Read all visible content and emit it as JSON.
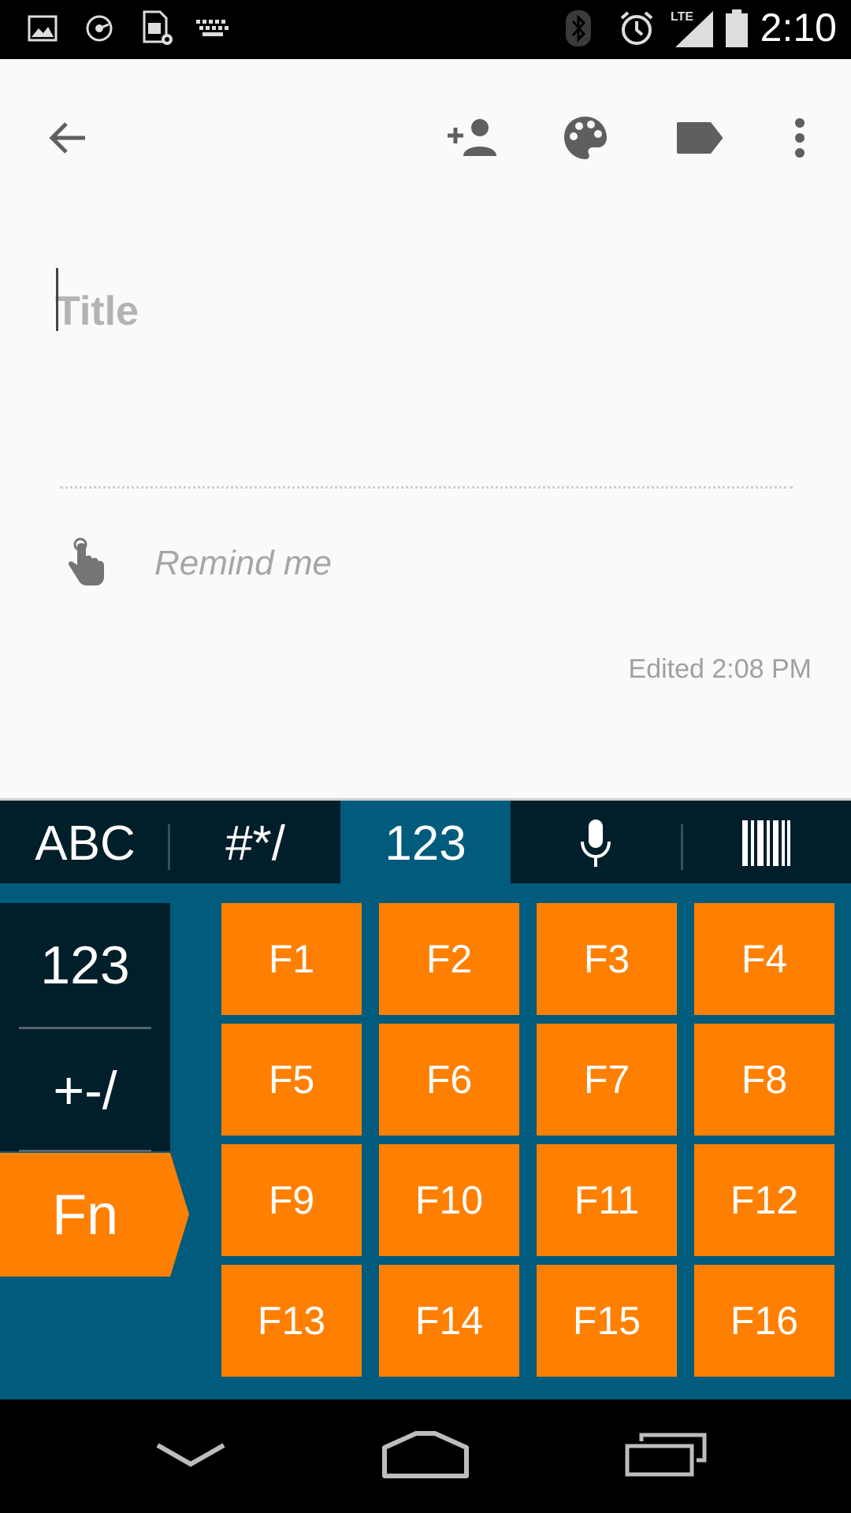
{
  "status_bar": {
    "time": "2:10",
    "network_label": "LTE",
    "left_icons": [
      "image-icon",
      "sync-icon",
      "sim-settings-icon",
      "keyboard-icon"
    ],
    "right_icons": [
      "bluetooth-icon",
      "alarm-icon",
      "signal-icon",
      "battery-icon"
    ]
  },
  "toolbar": {
    "icons": [
      "back-arrow-icon",
      "add-collaborator-icon",
      "palette-icon",
      "label-icon",
      "more-vert-icon"
    ]
  },
  "note": {
    "title_placeholder": "Title",
    "title_value": "",
    "remind_label": "Remind me",
    "edited_text": "Edited 2:08 PM"
  },
  "keyboard": {
    "tabs": [
      {
        "label": "ABC",
        "active": false
      },
      {
        "label": "#*/",
        "active": false
      },
      {
        "label": "123",
        "active": true
      },
      {
        "label": "mic-icon",
        "active": false
      },
      {
        "label": "barcode-icon",
        "active": false
      }
    ],
    "mode_buttons": [
      "123",
      "+-/",
      "Fn"
    ],
    "selected_mode": "Fn",
    "function_keys": [
      "F1",
      "F2",
      "F3",
      "F4",
      "F5",
      "F6",
      "F7",
      "F8",
      "F9",
      "F10",
      "F11",
      "F12",
      "F13",
      "F14",
      "F15",
      "F16"
    ],
    "colors": {
      "accent": "#ff8000",
      "keyboard_bg": "#015b7c",
      "dark_bg": "#011e2b"
    }
  },
  "nav_bar": {
    "buttons": [
      "hide-keyboard-icon",
      "home-icon",
      "recents-icon"
    ]
  }
}
